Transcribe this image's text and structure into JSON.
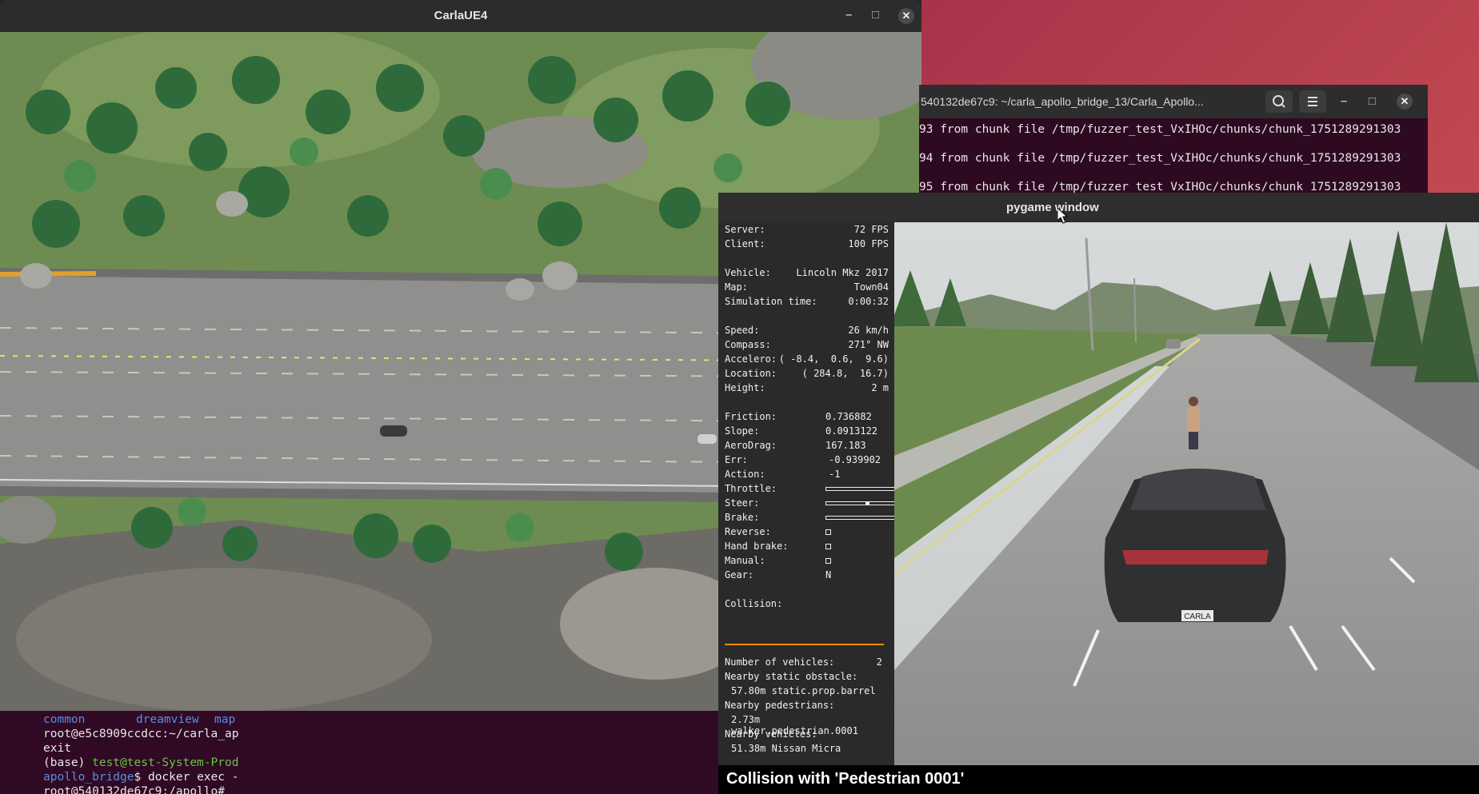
{
  "carla_window": {
    "title": "CarlaUE4",
    "controls": {
      "minimize": "–",
      "maximize": "□",
      "close": "✕"
    }
  },
  "terminal_back": {
    "title": "540132de67c9: ~/carla_apollo_bridge_13/Carla_Apollo...",
    "lines": [
      "93 from chunk file /tmp/fuzzer_test_VxIHOc/chunks/chunk_1751289291303",
      "94 from chunk file /tmp/fuzzer_test_VxIHOc/chunks/chunk_1751289291303",
      "95 from chunk file /tmp/fuzzer_test_VxIHOc/chunks/chunk_1751289291303"
    ]
  },
  "terminal_front": {
    "ls_items": [
      "common",
      "dreamview",
      "map"
    ],
    "line_prompt": "root@e5c8909ccdcc:~/carla_ap",
    "line_exit": "exit",
    "line_base": "(base) ",
    "line_user": "test@test-System-Prod",
    "line_dir": "apollo_bridge",
    "line_cmd": "$ docker exec -",
    "line_last": "root@540132de67c9:/apollo#"
  },
  "pygame": {
    "title": "pygame window",
    "hud": {
      "server_label": "Server:",
      "server_value": "72 FPS",
      "client_label": "Client:",
      "client_value": "100 FPS",
      "vehicle_label": "Vehicle:",
      "vehicle_value": "Lincoln Mkz 2017",
      "map_label": "Map:",
      "map_value": "Town04",
      "simtime_label": "Simulation time:",
      "simtime_value": "0:00:32",
      "speed_label": "Speed:",
      "speed_value": "26 km/h",
      "compass_label": "Compass:",
      "compass_value": "271° NW",
      "accel_label": "Accelero:",
      "accel_value": "( -8.4,  0.6,  9.6)",
      "location_label": "Location:",
      "location_value": "( 284.8,  16.7)",
      "height_label": "Height:",
      "height_value": "2 m",
      "friction_label": "Friction:",
      "friction_value": "0.736882",
      "slope_label": "Slope:",
      "slope_value": "0.0913122",
      "aerodrag_label": "AeroDrag:",
      "aerodrag_value": "167.183",
      "err_label": "Err:",
      "err_value": "-0.939902",
      "action_label": "Action:",
      "action_value": "-1",
      "throttle_label": "Throttle:",
      "throttle_value": 0.0,
      "steer_label": "Steer:",
      "steer_value": 0.0,
      "brake_label": "Brake:",
      "brake_value": 0.0,
      "reverse_label": "Reverse:",
      "handbrake_label": "Hand brake:",
      "manual_label": "Manual:",
      "gear_label": "Gear:",
      "gear_value": "N",
      "collision_label": "Collision:",
      "nvehicles_label": "Number of vehicles:",
      "nvehicles_value": "2",
      "static_label": "Nearby static obstacle:",
      "static_value": "57.80m static.prop.barrel",
      "ped_label": "Nearby pedestrians:",
      "ped_value": "2.73m walker.pedestrian.0001",
      "veh_label": "Nearby vehicles:",
      "veh_value": "51.38m Nissan Micra"
    },
    "plate": "CARLA",
    "notification": "Collision with 'Pedestrian 0001'"
  }
}
